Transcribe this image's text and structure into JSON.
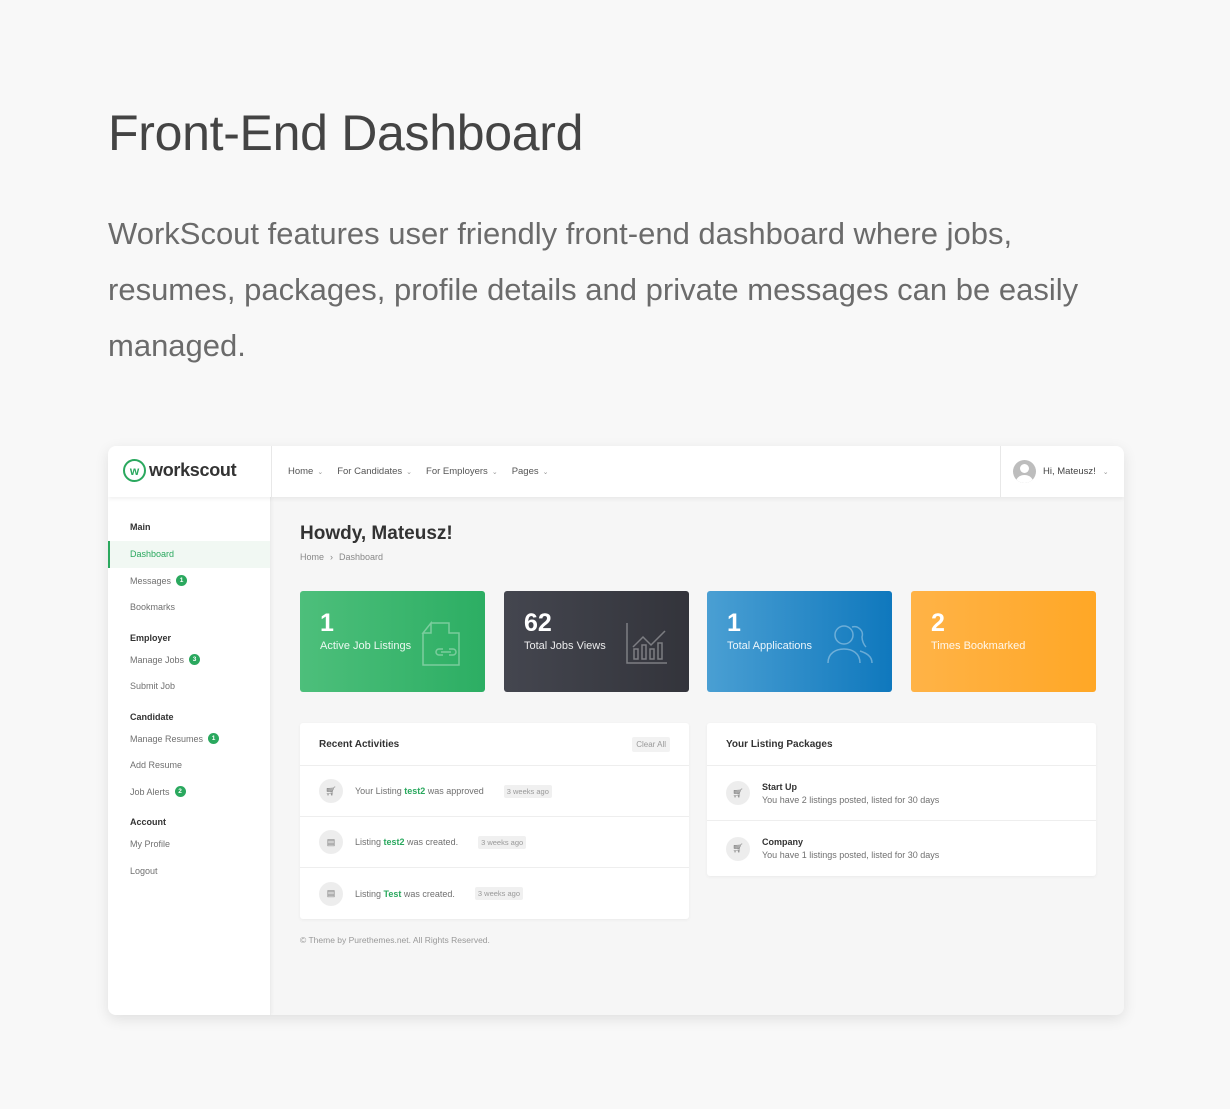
{
  "hero": {
    "title": "Front-End Dashboard",
    "description": "WorkScout features user friendly front-end dashboard where jobs, resumes, packages, profile details and private messages can be easily managed."
  },
  "app": {
    "logo_mark": "w",
    "logo_text": "workscout",
    "nav": [
      {
        "label": "Home"
      },
      {
        "label": "For Candidates"
      },
      {
        "label": "For Employers"
      },
      {
        "label": "Pages"
      }
    ],
    "nav_chevron": "⌄",
    "user_greeting": "Hi, Mateusz!",
    "brand_color": "#2aa85e"
  },
  "sidebar": {
    "groups": [
      {
        "title": "Main",
        "items": [
          {
            "label": "Dashboard",
            "active": true
          },
          {
            "label": "Messages",
            "badge": "1"
          },
          {
            "label": "Bookmarks"
          }
        ]
      },
      {
        "title": "Employer",
        "items": [
          {
            "label": "Manage Jobs",
            "badge": "3"
          },
          {
            "label": "Submit Job"
          }
        ]
      },
      {
        "title": "Candidate",
        "items": [
          {
            "label": "Manage Resumes",
            "badge": "1"
          },
          {
            "label": "Add Resume"
          },
          {
            "label": "Job Alerts",
            "badge": "2"
          }
        ]
      },
      {
        "title": "Account",
        "items": [
          {
            "label": "My Profile"
          },
          {
            "label": "Logout"
          }
        ]
      }
    ]
  },
  "main": {
    "greeting": "Howdy, Mateusz!",
    "breadcrumb": [
      "Home",
      "Dashboard"
    ],
    "breadcrumb_sep": "›",
    "stats": [
      {
        "value": "1",
        "label": "Active Job Listings",
        "icon": "document-link-icon",
        "color": "#2cae63"
      },
      {
        "value": "62",
        "label": "Total Jobs Views",
        "icon": "bar-chart-icon",
        "color": "#33343b"
      },
      {
        "value": "1",
        "label": "Total Applications",
        "icon": "people-icon",
        "color": "#0f78bd"
      },
      {
        "value": "2",
        "label": "Times Bookmarked",
        "icon": "bookmark-icon",
        "color": "#ffa726"
      }
    ],
    "activities": {
      "title": "Recent Activities",
      "clear_label": "Clear All",
      "items": [
        {
          "icon": "cart-icon",
          "pre": "Your Listing ",
          "link": "test2",
          "post": " was approved",
          "time": "3 weeks ago"
        },
        {
          "icon": "file-icon",
          "pre": "Listing ",
          "link": "test2",
          "post": " was created.",
          "time": "3 weeks ago"
        },
        {
          "icon": "file-icon",
          "pre": "Listing ",
          "link": "Test",
          "post": " was created.",
          "time": "3 weeks ago"
        }
      ]
    },
    "packages": {
      "title": "Your Listing Packages",
      "items": [
        {
          "name": "Start Up",
          "desc": "You have 2 listings posted, listed for 30 days"
        },
        {
          "name": "Company",
          "desc": "You have 1 listings posted, listed for 30 days"
        }
      ]
    },
    "footer": "© Theme by Purethemes.net. All Rights Reserved."
  }
}
